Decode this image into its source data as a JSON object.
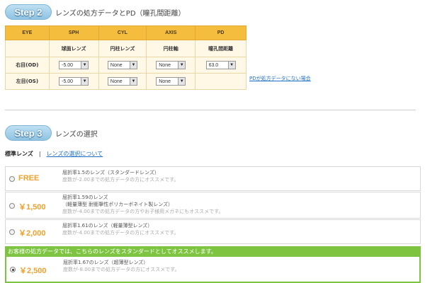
{
  "step2": {
    "badge": "Step 2",
    "title": "レンズの処方データとPD（瞳孔間距離）"
  },
  "table": {
    "headers": [
      "EYE",
      "SPH",
      "CYL",
      "AXIS",
      "PD"
    ],
    "subheaders": [
      "球面レンズ",
      "円柱レンズ",
      "円柱軸",
      "瞳孔間距離"
    ],
    "rows": [
      {
        "eye": "右目(OD)",
        "sph": "-5.00",
        "cyl": "None",
        "axis": "None",
        "pd": "63.0"
      },
      {
        "eye": "左目(OS)",
        "sph": "-5.00",
        "cyl": "None",
        "axis": "None"
      }
    ]
  },
  "nopd_link": "PDが処方データにない場合",
  "step3": {
    "badge": "Step 3",
    "title": "レンズの選択"
  },
  "tabs": {
    "standard": "標準レンズ",
    "separator": "|",
    "about": "レンズの選択について"
  },
  "lenses": [
    {
      "price": "FREE",
      "title": "屈折率1.5のレンズ（スタンダードレンズ）",
      "sub1": "度数が-2.00までの処方データの方にオススメです。",
      "selected": false
    },
    {
      "price": "￥1,500",
      "title": "屈折率1.59のレンズ",
      "title2": "（軽量薄型 耐衝撃性ポリカーボネイト製レンズ）",
      "sub1": "度数が-4.00までの処方データの方やお子様用メガネにもオススメです。",
      "selected": false
    },
    {
      "price": "￥2,000",
      "title": "屈折率1.61のレンズ（軽量薄型レンズ）",
      "sub1": "度数が-4.00までの処方データの方にオススメです。",
      "selected": false
    },
    {
      "price": "￥2,500",
      "title": "屈折率1.67のレンズ（超薄型レンズ）",
      "sub1": "度数が-8.00までの処方データの方にオススメです。",
      "selected": true
    }
  ],
  "recommend_bar": "お客様の処方データでは、こちらのレンズをスタンダードとしてオススメします。",
  "colors": {
    "header_orange": "#f5bd3e",
    "price_orange": "#f0a12c",
    "recommend_green": "#7dc541",
    "link_blue": "#1d6fc7"
  }
}
